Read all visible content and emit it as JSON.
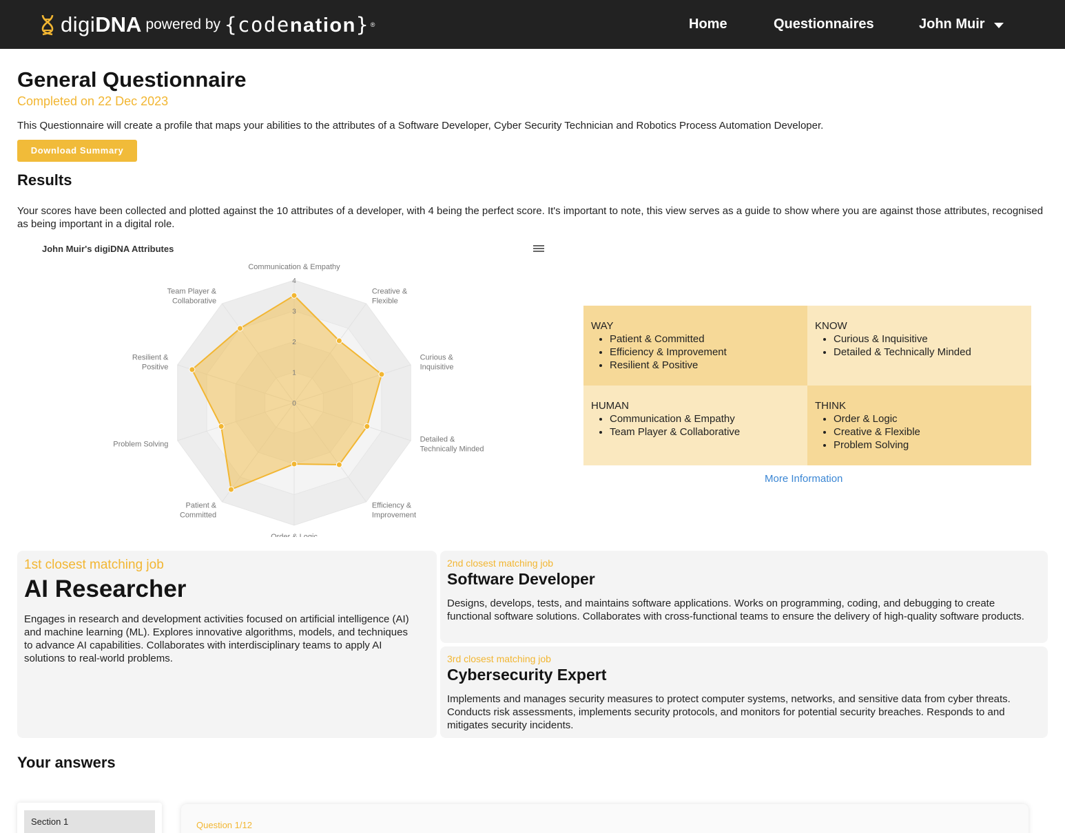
{
  "nav": {
    "logo": {
      "digi": "digi",
      "dna": "DNA",
      "powered_by": "powered by",
      "brand_open": "{c",
      "brand_o": "o",
      "brand_de": "de",
      "brand_nation": "nation",
      "brand_close": "}",
      "reg": "®"
    },
    "home": "Home",
    "questionnaires": "Questionnaires",
    "user": "John Muir"
  },
  "header": {
    "title": "General Questionnaire",
    "completed": "Completed on 22 Dec 2023",
    "intro": "This Questionnaire will create a profile that maps your abilities to the attributes of a Software Developer, Cyber Security Technician and Robotics Process Automation Developer.",
    "download_label": "Download Summary"
  },
  "results": {
    "heading": "Results",
    "text": "Your scores have been collected and plotted against the 10 attributes of a developer, with 4 being the perfect score. It's important to note, this view serves as a guide to show where you are against those attributes, recognised as being important in a digital role."
  },
  "chart_data": {
    "type": "radar",
    "title": "John Muir's digiDNA Attributes",
    "categories": [
      [
        "Communication & Empathy"
      ],
      [
        "Creative &",
        "Flexible"
      ],
      [
        "Curious &",
        "Inquisitive"
      ],
      [
        "Detailed &",
        "Technically Minded"
      ],
      [
        "Efficiency &",
        "Improvement"
      ],
      [
        "Order & Logic"
      ],
      [
        "Patient &",
        "Committed"
      ],
      [
        "Problem Solving"
      ],
      [
        "Resilient &",
        "Positive"
      ],
      [
        "Team Player &",
        "Collaborative"
      ]
    ],
    "values": [
      3.5,
      2.5,
      3.0,
      2.5,
      2.5,
      2.0,
      3.5,
      2.5,
      3.5,
      3.0
    ],
    "ylim": [
      0,
      4
    ],
    "ticks": [
      "0",
      "1",
      "2",
      "3",
      "4"
    ],
    "series_color": "#f2b632"
  },
  "quadrants": {
    "way": {
      "title": "WAY",
      "items": [
        "Patient & Committed",
        "Efficiency & Improvement",
        "Resilient & Positive"
      ]
    },
    "know": {
      "title": "KNOW",
      "items": [
        "Curious & Inquisitive",
        "Detailed & Technically Minded"
      ]
    },
    "human": {
      "title": "HUMAN",
      "items": [
        "Communication & Empathy",
        "Team Player & Collaborative"
      ]
    },
    "think": {
      "title": "THINK",
      "items": [
        "Order & Logic",
        "Creative & Flexible",
        "Problem Solving"
      ]
    },
    "more_info": "More Information"
  },
  "jobs": [
    {
      "rank": "1st closest matching job",
      "title": "AI Researcher",
      "desc": "Engages in research and development activities focused on artificial intelligence (AI) and machine learning (ML). Explores innovative algorithms, models, and techniques to advance AI capabilities. Collaborates with interdisciplinary teams to apply AI solutions to real-world problems."
    },
    {
      "rank": "2nd closest matching job",
      "title": "Software Developer",
      "desc": "Designs, develops, tests, and maintains software applications. Works on programming, coding, and debugging to create functional software solutions. Collaborates with cross-functional teams to ensure the delivery of high-quality software products."
    },
    {
      "rank": "3rd closest matching job",
      "title": "Cybersecurity Expert",
      "desc": "Implements and manages security measures to protect computer systems, networks, and sensitive data from cyber threats. Conducts risk assessments, implements security protocols, and monitors for potential security breaches. Responds to and mitigates security incidents."
    }
  ],
  "answers": {
    "heading": "Your answers",
    "section": "Section 1",
    "question": "Question 1/12"
  },
  "colors": {
    "nav_bg": "#222222",
    "accent": "#f2b632",
    "link": "#3a86d4"
  }
}
